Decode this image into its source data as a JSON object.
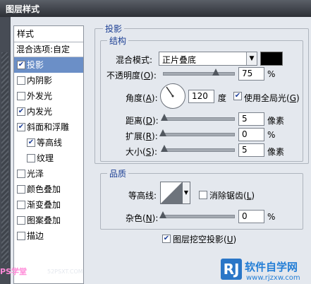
{
  "window": {
    "title": "图层样式"
  },
  "stylelist": {
    "header": "样式",
    "blending_options": "混合选项:自定",
    "items": [
      {
        "label": "投影",
        "checked": true,
        "selected": true
      },
      {
        "label": "内阴影",
        "checked": false
      },
      {
        "label": "外发光",
        "checked": false
      },
      {
        "label": "内发光",
        "checked": true
      },
      {
        "label": "斜面和浮雕",
        "checked": true
      },
      {
        "label": "等高线",
        "checked": true,
        "indent": true
      },
      {
        "label": "纹理",
        "checked": false,
        "indent": true
      },
      {
        "label": "光泽",
        "checked": false
      },
      {
        "label": "颜色叠加",
        "checked": false
      },
      {
        "label": "渐变叠加",
        "checked": false
      },
      {
        "label": "图案叠加",
        "checked": false
      },
      {
        "label": "描边",
        "checked": false
      }
    ]
  },
  "drop_shadow": {
    "section_title": "投影",
    "structure_title": "结构",
    "blend_mode_label": "混合模式:",
    "blend_mode_value": "正片叠底",
    "swatch_color": "#000000",
    "opacity_label_pre": "不透明度(",
    "opacity_key": "O",
    "opacity_label_post": "):",
    "opacity_value": "75",
    "opacity_unit": "%",
    "opacity_level": 75,
    "angle_label_pre": "角度(",
    "angle_key": "A",
    "angle_label_post": "):",
    "angle_value": "120",
    "angle_unit": "度",
    "use_global_light_pre": "使用全局光(",
    "use_global_light_key": "G",
    "use_global_light_post": ")",
    "use_global_light_checked": true,
    "distance_label_pre": "距离(",
    "distance_key": "D",
    "distance_label_post": "):",
    "distance_value": "5",
    "distance_unit": "像素",
    "spread_label_pre": "扩展(",
    "spread_key": "R",
    "spread_label_post": "):",
    "spread_value": "0",
    "spread_unit": "%",
    "size_label_pre": "大小(",
    "size_key": "S",
    "size_label_post": "):",
    "size_value": "5",
    "size_unit": "像素"
  },
  "quality": {
    "title": "品质",
    "contour_label": "等高线:",
    "antialias_pre": "消除锯齿(",
    "antialias_key": "L",
    "antialias_post": ")",
    "antialias_checked": false,
    "noise_label_pre": "杂色(",
    "noise_key": "N",
    "noise_label_post": "):",
    "noise_value": "0",
    "noise_unit": "%",
    "knockout_pre": "图层挖空投影(",
    "knockout_key": "U",
    "knockout_post": ")",
    "knockout_checked": true
  },
  "watermarks": {
    "left": "PS学堂",
    "left_sub": "52PSXT.COM",
    "logo_badge": "RJ",
    "logo_name": "软件自学网",
    "logo_url": "www.rjzxw.com"
  },
  "colors": {
    "selection": "#6b8fc7",
    "accent_text": "#1c3f94"
  }
}
